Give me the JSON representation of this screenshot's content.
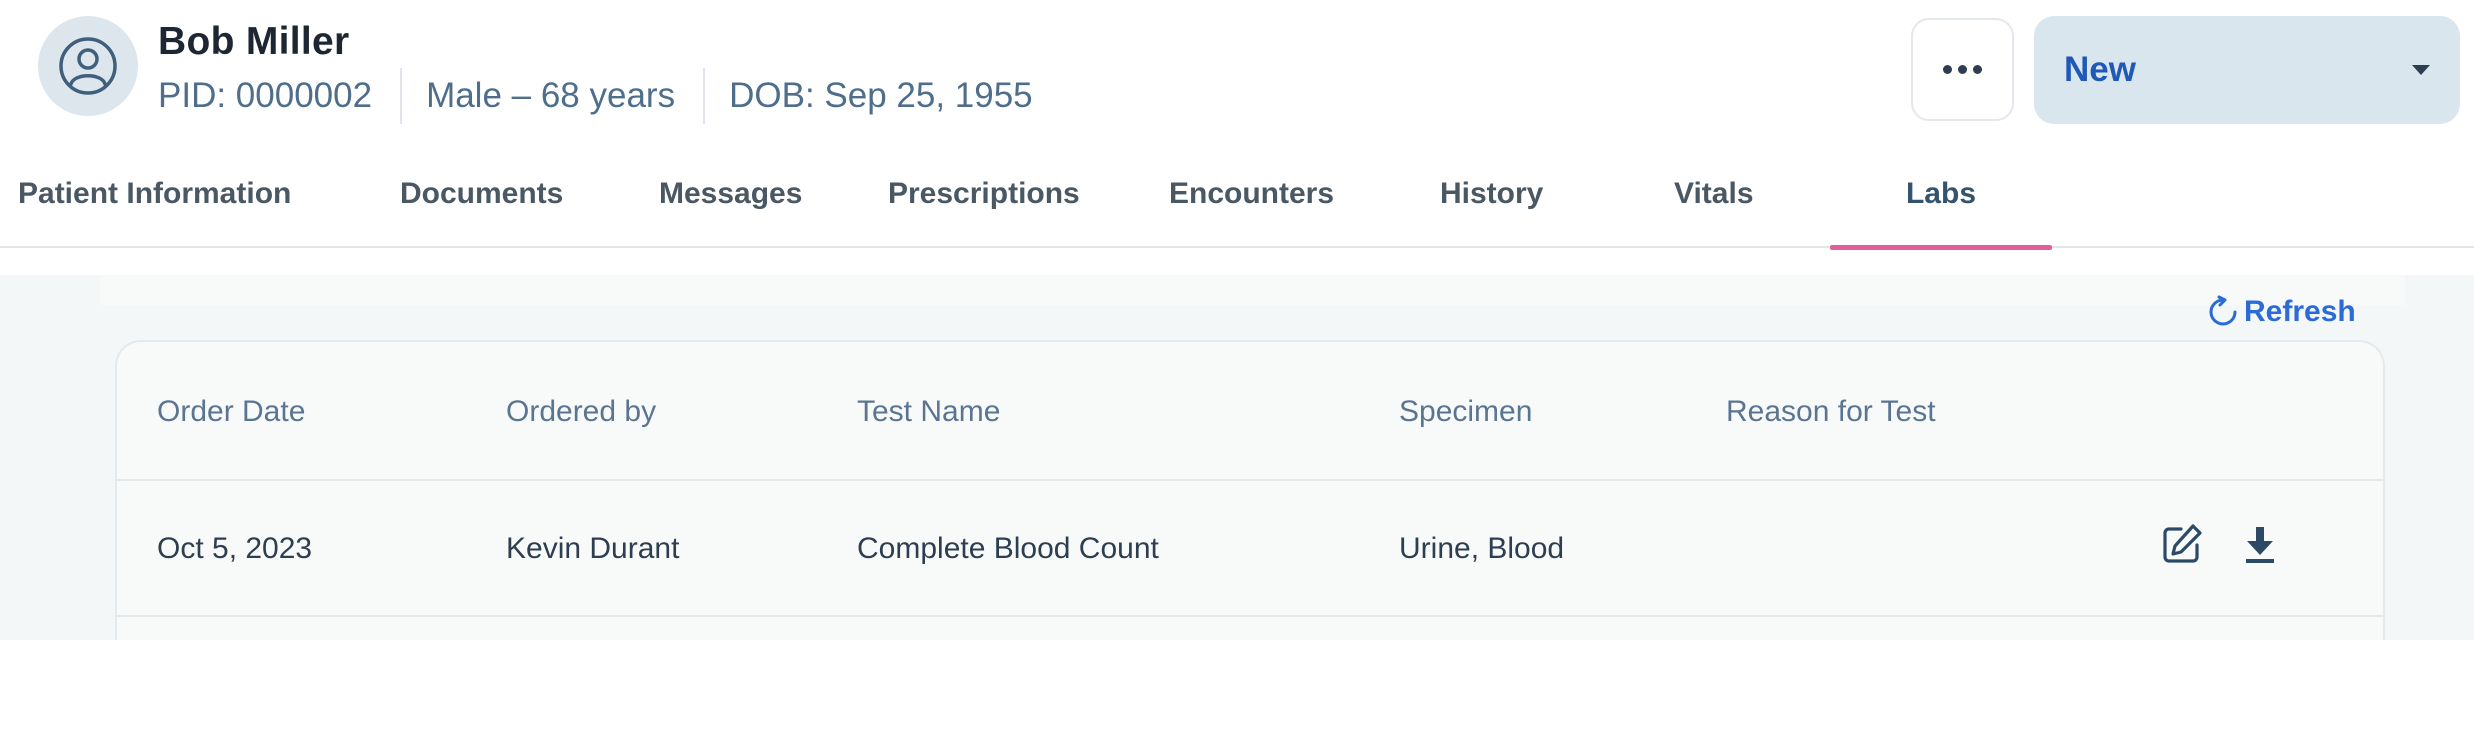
{
  "patient": {
    "name": "Bob Miller",
    "pid": "PID: 0000002",
    "gender_age": "Male – 68 years",
    "dob": "DOB: Sep 25, 1955"
  },
  "header": {
    "more_icon": "more-horizontal-icon",
    "new_button_label": "New"
  },
  "tabs": [
    {
      "label": "Patient Information"
    },
    {
      "label": "Documents"
    },
    {
      "label": "Messages"
    },
    {
      "label": "Prescriptions"
    },
    {
      "label": "Encounters"
    },
    {
      "label": "History"
    },
    {
      "label": "Vitals"
    },
    {
      "label": "Labs",
      "active": true
    }
  ],
  "labs": {
    "refresh_label": "Refresh",
    "columns": [
      "Order Date",
      "Ordered by",
      "Test Name",
      "Specimen",
      "Reason for Test"
    ],
    "rows": [
      {
        "order_date": "Oct 5, 2023",
        "ordered_by": "Kevin Durant",
        "test_name": "Complete Blood Count",
        "specimen": "Urine, Blood",
        "reason": ""
      }
    ]
  },
  "colors": {
    "accent": "#2058b8",
    "active_tab_indicator": "#e2609a",
    "new_button_bg": "#dae6ee",
    "refresh": "#2a6bd8"
  }
}
